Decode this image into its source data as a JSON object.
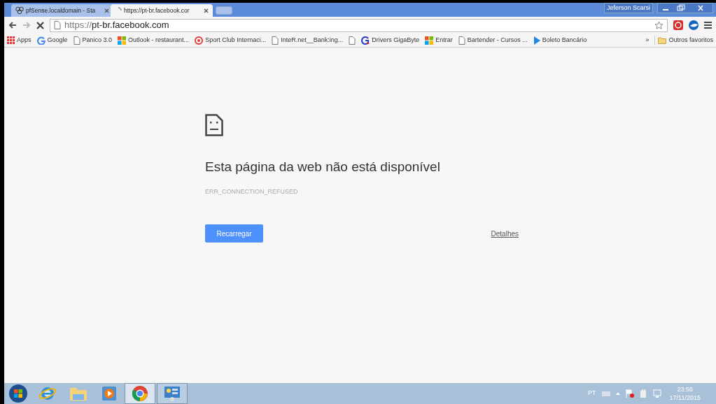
{
  "tabs": [
    {
      "title": "pfSense.localdomain - Sta",
      "kind": "logo",
      "selected": false
    },
    {
      "title": "https://pt-br.facebook.cor",
      "kind": "loading",
      "selected": true
    }
  ],
  "profile": "Jeferson Scarsi",
  "address": {
    "scheme": "https://",
    "host": "pt-br.facebook.com"
  },
  "bookmarks": [
    {
      "label": "Apps",
      "kind": "grid"
    },
    {
      "label": "Google",
      "kind": "google"
    },
    {
      "label": "Panico 3.0",
      "kind": "page"
    },
    {
      "label": "Outlook - restaurant...",
      "kind": "windows"
    },
    {
      "label": "Sport Club Internaci...",
      "kind": "club"
    },
    {
      "label": "InteR.net__Bank:ing...",
      "kind": "page"
    },
    {
      "kind": "page"
    },
    {
      "label": "Drivers GigaByte",
      "kind": "gigabyte"
    },
    {
      "label": "Entrar",
      "kind": "windows"
    },
    {
      "label": "Bartender - Cursos ...",
      "kind": "page"
    },
    {
      "label": "Boleto Bancário",
      "kind": "play"
    }
  ],
  "bookmarks_overflow": "»",
  "other_bookmarks": "Outros favoritos",
  "error": {
    "heading": "Esta página da web não está disponível",
    "code": "ERR_CONNECTION_REFUSED",
    "reload": "Recarregar",
    "details": "Detalhes"
  },
  "taskbar": {
    "apps": [
      {
        "kind": "ie",
        "running": false,
        "selected": false
      },
      {
        "kind": "folder",
        "running": false,
        "selected": false
      },
      {
        "kind": "media",
        "running": false,
        "selected": false
      },
      {
        "kind": "chrome",
        "running": true,
        "selected": true
      },
      {
        "kind": "remote",
        "running": true,
        "selected": false
      }
    ],
    "language": "PT",
    "time": "23:56",
    "date": "17/11/2015"
  }
}
